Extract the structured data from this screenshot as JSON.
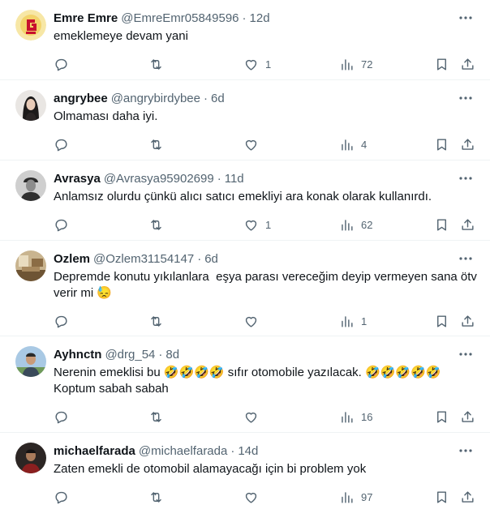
{
  "tweets": [
    {
      "name": "Emre Emre",
      "handle": "@EmreEmr05849596",
      "time": "12d",
      "text": "emeklemeye devam yani",
      "likes": "1",
      "views": "72",
      "avatar": "galatasaray-logo"
    },
    {
      "name": "angrybee",
      "handle": "@angrybirdybee",
      "time": "6d",
      "text": "Olmaması daha iyi.",
      "likes": "",
      "views": "4",
      "avatar": "woman-photo"
    },
    {
      "name": "Avrasya",
      "handle": "@Avrasya95902699",
      "time": "11d",
      "text": "Anlamsız olurdu çünkü alıcı satıcı emekliyi ara konak olarak kullanırdı.",
      "likes": "1",
      "views": "62",
      "avatar": "ataturk-portrait"
    },
    {
      "name": "Ozlem",
      "handle": "@Ozlem31154147",
      "time": "6d",
      "text": "Depremde konutu yıkılanlara  eşya parası vereceğim deyip vermeyen sana ötv verir mi 😓",
      "likes": "",
      "views": "1",
      "avatar": "room-photo"
    },
    {
      "name": "Ayhnctn",
      "handle": "@drg_54",
      "time": "8d",
      "text": "Nerenin emeklisi bu 🤣🤣🤣🤣 sıfır otomobile yazılacak. 🤣🤣🤣🤣🤣\nKoptum sabah sabah",
      "likes": "",
      "views": "16",
      "avatar": "man-outdoor-photo"
    },
    {
      "name": "michaelfarada",
      "handle": "@michaelfarada",
      "time": "14d",
      "text": "Zaten emekli de otomobil alamayacağı için bi problem yok",
      "likes": "",
      "views": "97",
      "avatar": "man-dark-photo"
    }
  ],
  "separator": "·",
  "icons": [
    "more-icon",
    "reply-icon",
    "retweet-icon",
    "like-icon",
    "views-icon",
    "bookmark-icon",
    "share-icon"
  ],
  "colors": {
    "text": "#0f1419",
    "secondary": "#536471",
    "divider": "#eff3f4",
    "background": "#ffffff"
  }
}
